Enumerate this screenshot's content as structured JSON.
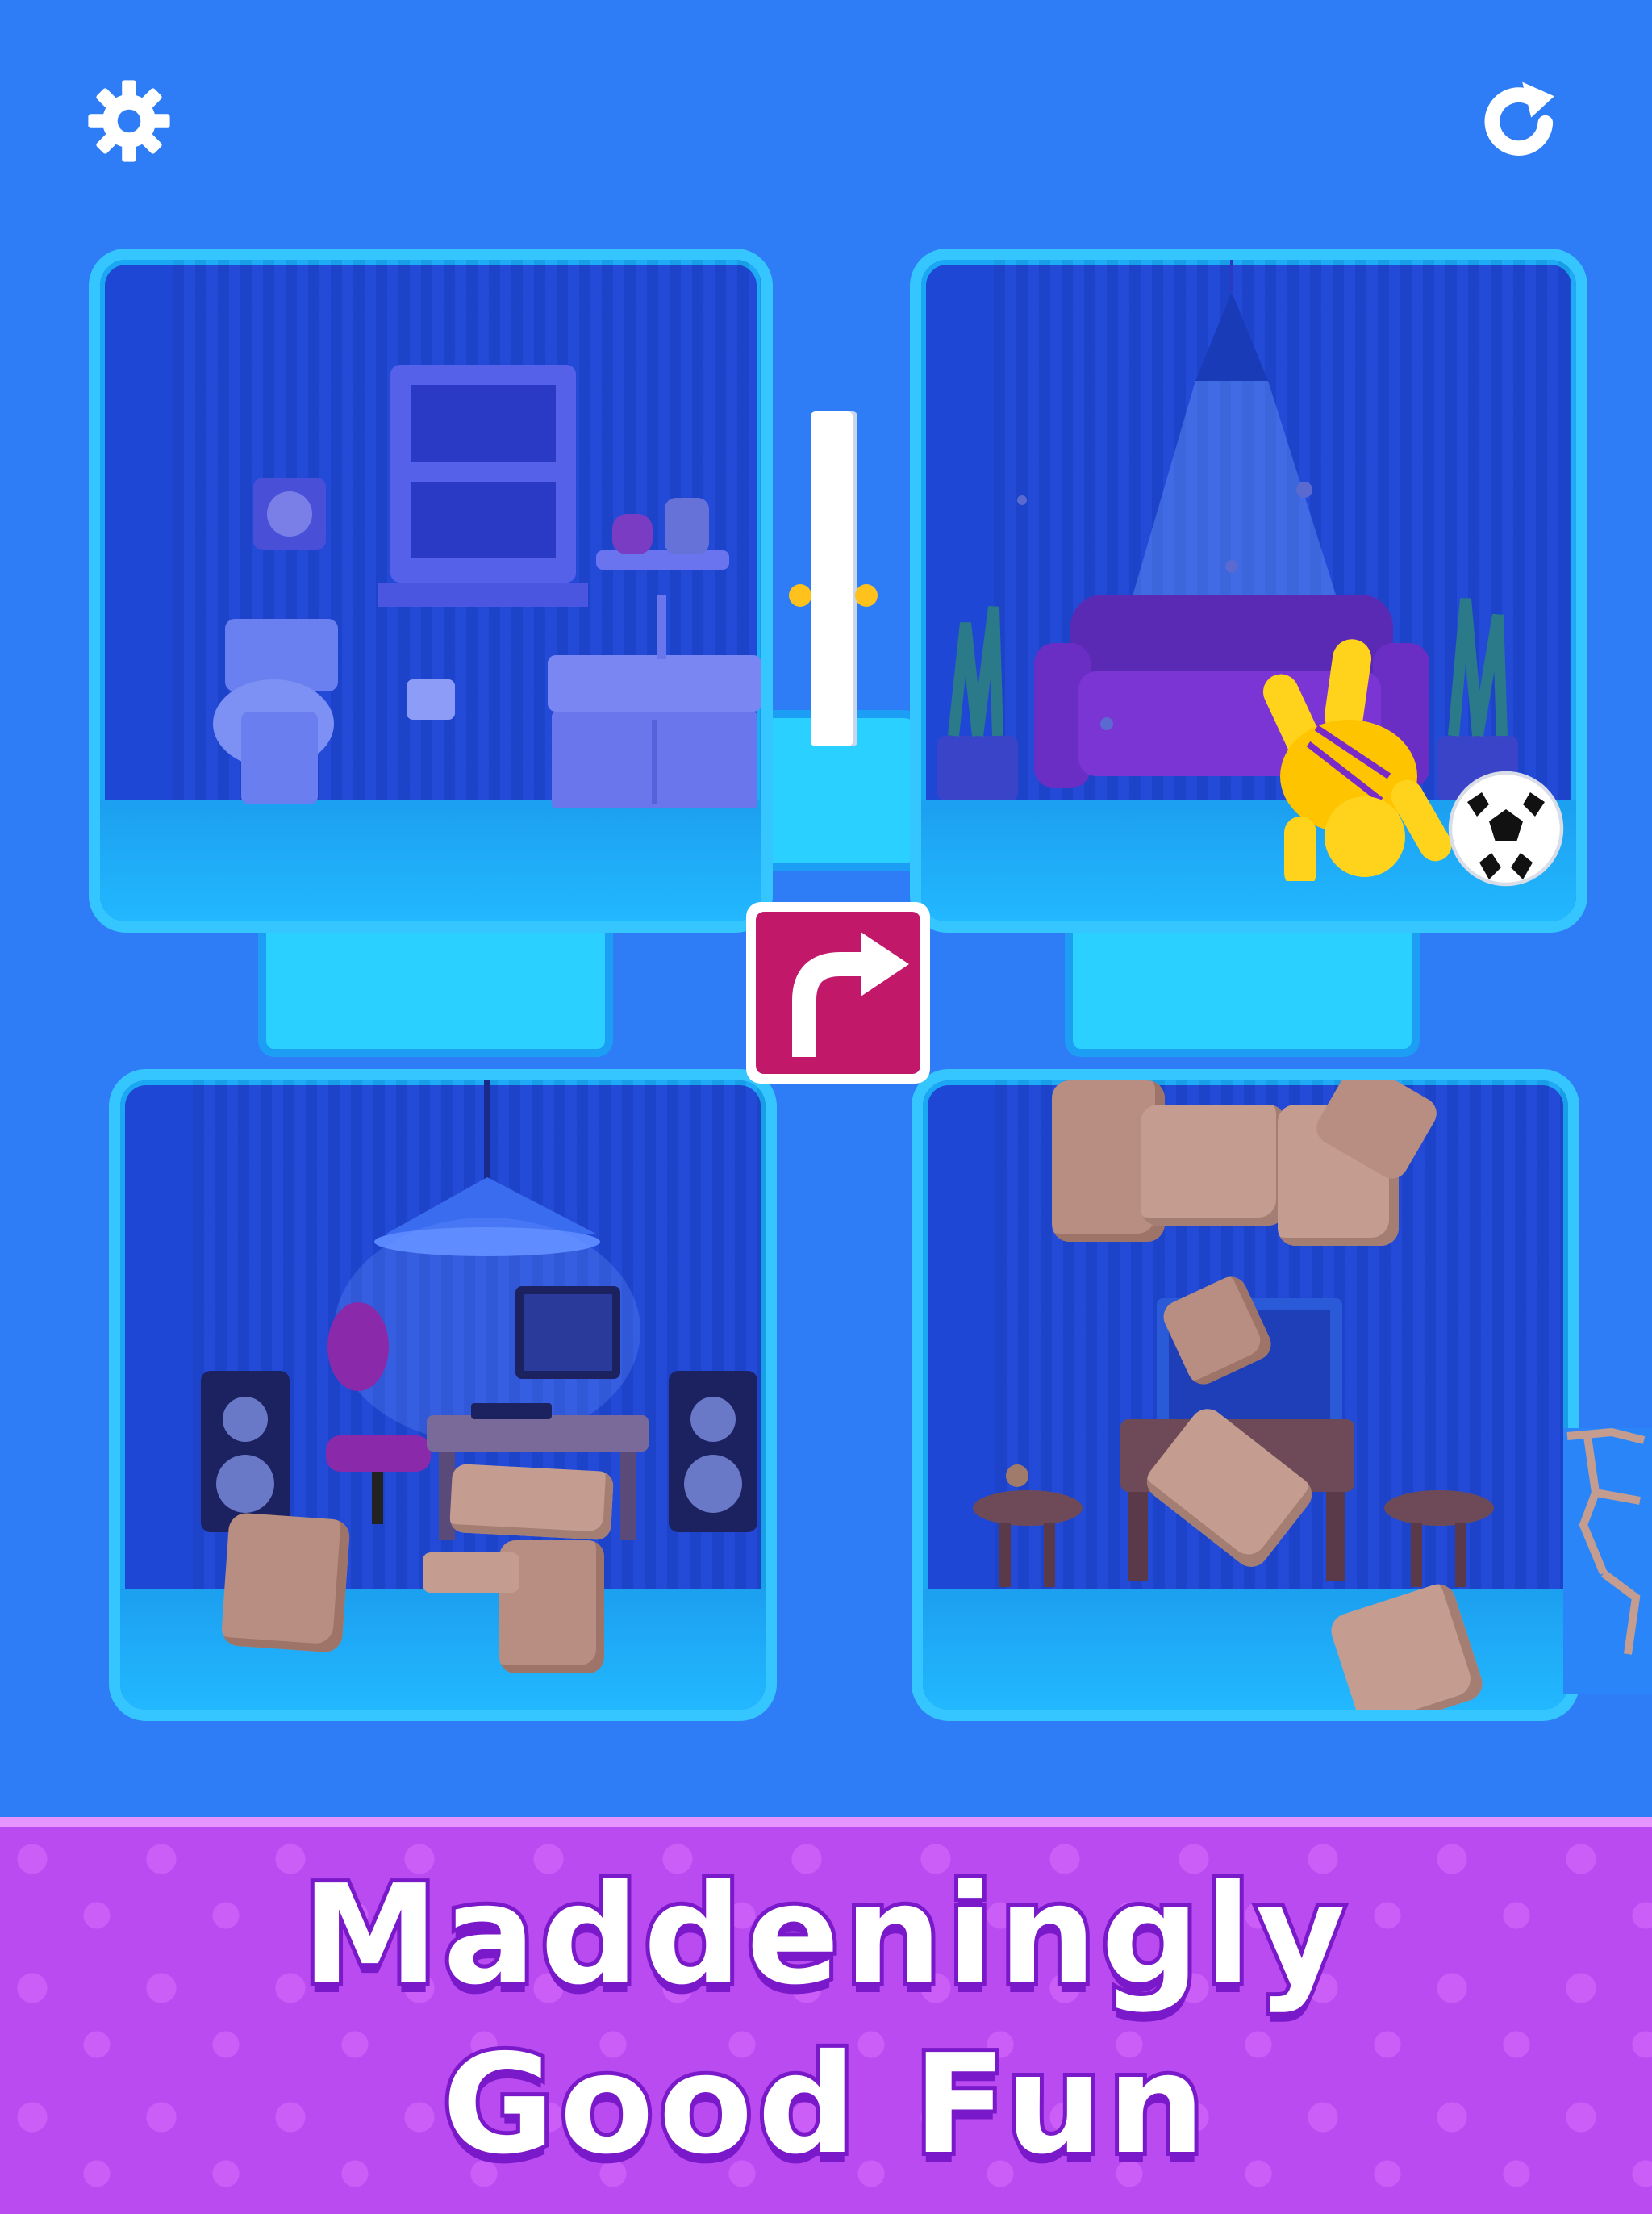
{
  "hud": {
    "settings_icon": "gear-icon",
    "restart_icon": "restart-icon"
  },
  "rooms": [
    "bathroom",
    "living-room",
    "office",
    "dining-room"
  ],
  "game": {
    "center_sign_icon": "turn-right-arrow-icon",
    "sign_color": "#c2186a",
    "character_color": "#ffd21c",
    "accent_blue": "#2e7cf6"
  },
  "banner": {
    "line1": "Maddeningly",
    "line2": "Good Fun",
    "color": "#b94bf0"
  }
}
